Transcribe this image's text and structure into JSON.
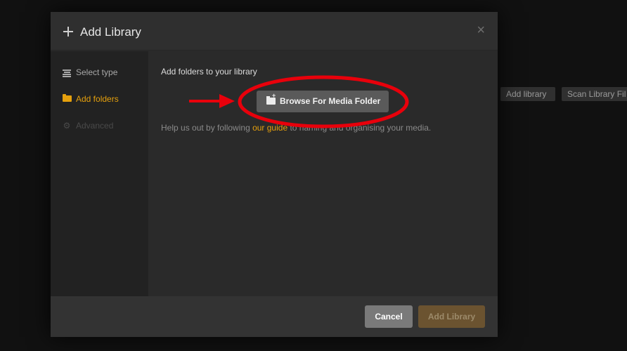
{
  "background": {
    "add_library_label": "Add library",
    "scan_library_label": "Scan Library Fil"
  },
  "modal": {
    "title": "Add Library",
    "close_glyph": "×"
  },
  "sidebar": {
    "items": [
      {
        "label": "Select type",
        "state": "normal",
        "icon": "list-icon"
      },
      {
        "label": "Add folders",
        "state": "active",
        "icon": "folder-icon"
      },
      {
        "label": "Advanced",
        "state": "disabled",
        "icon": "gear-icon"
      }
    ]
  },
  "main": {
    "heading": "Add folders to your library",
    "browse_button_label": "Browse For Media Folder",
    "help_prefix": "Help us out by following ",
    "help_link": "our guide",
    "help_suffix": " to naming and organising your media."
  },
  "footer": {
    "cancel_label": "Cancel",
    "add_library_label": "Add Library"
  },
  "colors": {
    "accent": "#e5a00d",
    "annotation_red": "#e8000b"
  }
}
